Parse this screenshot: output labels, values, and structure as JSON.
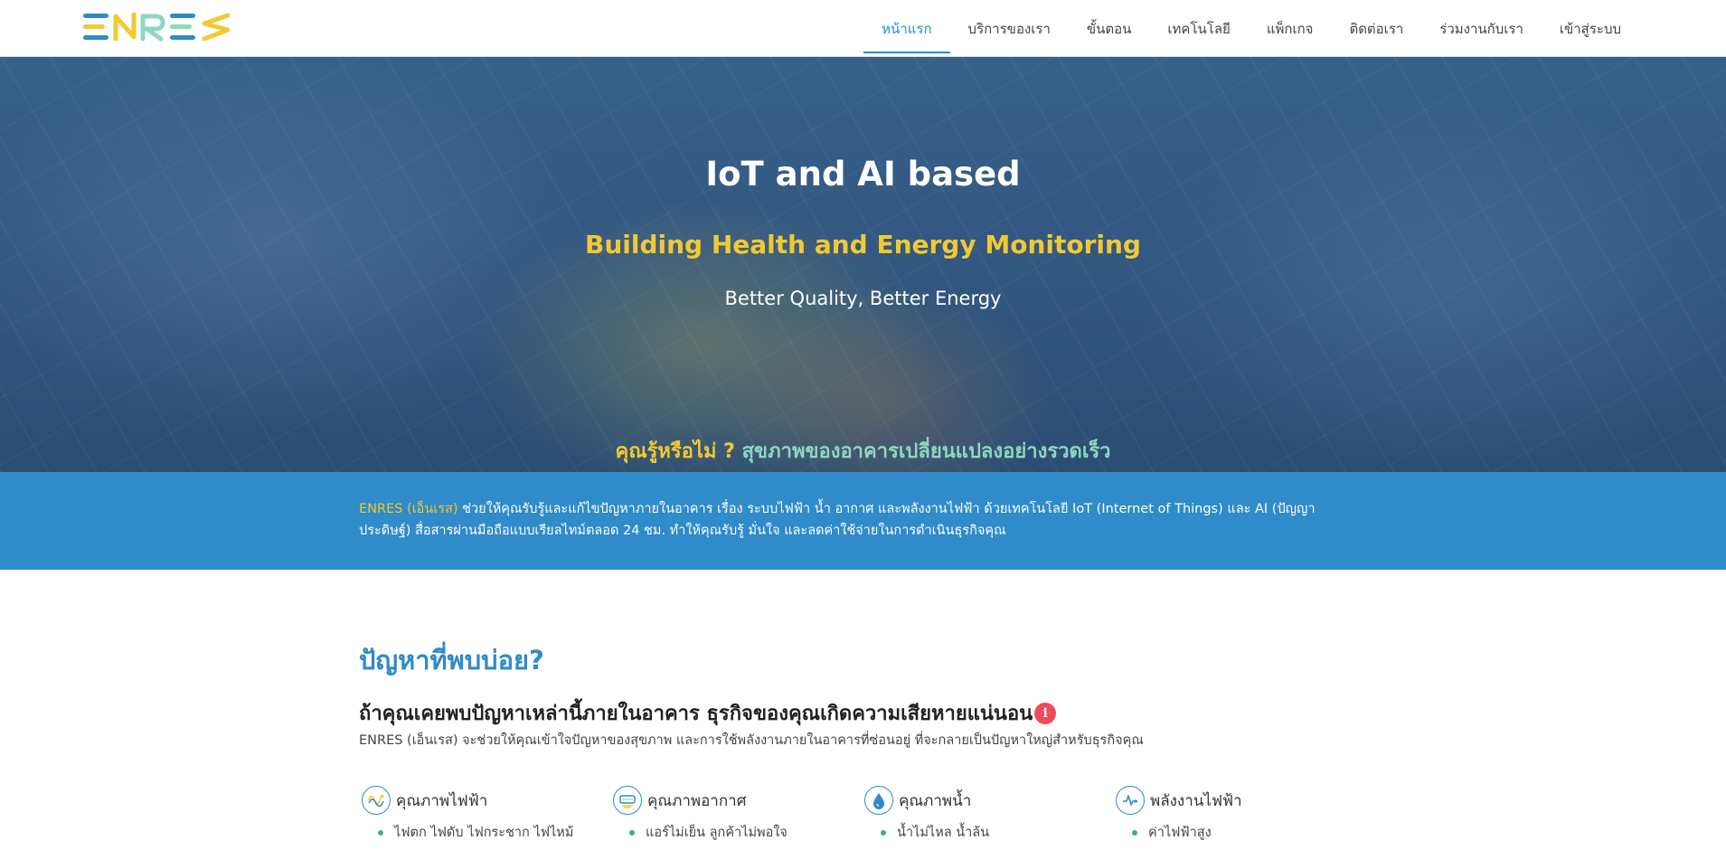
{
  "nav": {
    "logo_text": "ENRES",
    "items": [
      {
        "label": "หน้าแรก",
        "active": true
      },
      {
        "label": "บริการของเรา",
        "active": false
      },
      {
        "label": "ขั้นตอน",
        "active": false
      },
      {
        "label": "เทคโนโลยี",
        "active": false
      },
      {
        "label": "แพ็กเกจ",
        "active": false
      },
      {
        "label": "ติดต่อเรา",
        "active": false
      },
      {
        "label": "ร่วมงานกับเรา",
        "active": false
      },
      {
        "label": "เข้าสู่ระบบ",
        "active": false
      }
    ]
  },
  "hero": {
    "title": "IoT and AI based",
    "subtitle": "Building Health and Energy Monitoring",
    "tagline": "Better Quality, Better Energy",
    "question_part1": "คุณรู้หรือไม่ ?",
    "question_part2": "สุขภาพของอาคารเปลี่ยนแปลงอย่างรวดเร็ว"
  },
  "band": {
    "brand": "ENRES (เอ็นเรส)",
    "text": " ช่วยให้คุณรับรู้และแก้ไขปัญหาภายในอาคาร เรื่อง ระบบไฟฟ้า น้ำ อากาศ และพลังงานไฟฟ้า ด้วยเทคโนโลยี IoT (Internet of Things) และ AI (ปัญญาประดิษฐ์) สื่อสารผ่านมือถือแบบเรียลไทม์ตลอด 24 ชม. ทำให้คุณรับรู้ มั่นใจ และลดค่าใช้จ่ายในการดำเนินธุรกิจคุณ"
  },
  "problems": {
    "title": "ปัญหาที่พบบ่อย?",
    "heading": "ถ้าคุณเคยพบปัญหาเหล่านี้ภายในอาคาร ธุรกิจของคุณเกิดความเสียหายแน่นอน",
    "info_badge": "i",
    "description": "ENRES (เอ็นเรส) จะช่วยให้คุณเข้าใจปัญหาของสุขภาพ และการใช้พลังงานภายในอาคารที่ซ่อนอยู่ ที่จะกลายเป็นปัญหาใหญ่สำหรับธุรกิจคุณ",
    "columns": [
      {
        "title": "คุณภาพไฟฟ้า",
        "icon": "electric-wave-icon",
        "items": [
          "ไฟตก ไฟดับ ไฟกระชาก ไฟไหม้"
        ]
      },
      {
        "title": "คุณภาพอากาศ",
        "icon": "air-conditioner-icon",
        "items": [
          "แอร์ไม่เย็น ลูกค้าไม่พอใจ"
        ]
      },
      {
        "title": "คุณภาพน้ำ",
        "icon": "water-drop-icon",
        "items": [
          "น้ำไม่ไหล น้ำล้น"
        ]
      },
      {
        "title": "พลังงานไฟฟ้า",
        "icon": "energy-meter-icon",
        "items": [
          "ค่าไฟฟ้าสูง"
        ]
      }
    ]
  },
  "colors": {
    "primary_blue": "#2f8bc9",
    "accent_yellow": "#f3c932",
    "accent_mint": "#8dd8c0",
    "bullet_green": "#35b38a",
    "info_red": "#ef4b5f"
  }
}
